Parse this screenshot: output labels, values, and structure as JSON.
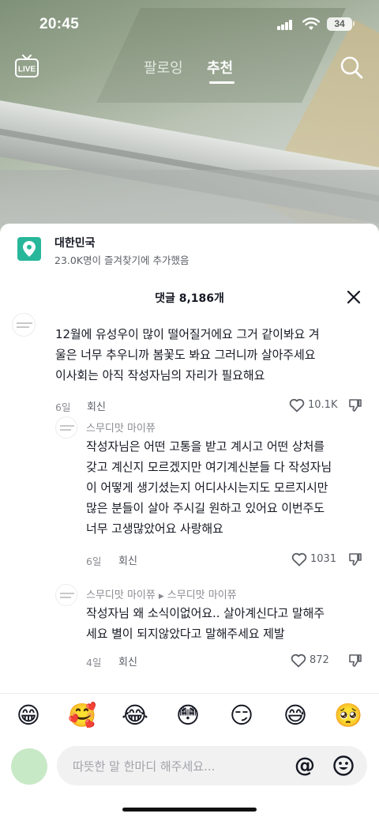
{
  "status_bar": {
    "time": "20:45",
    "battery": "34"
  },
  "top_nav": {
    "live_label": "LIVE",
    "tabs": [
      {
        "label": "팔로잉",
        "active": false
      },
      {
        "label": "추천",
        "active": true
      }
    ]
  },
  "location": {
    "title": "대한민국",
    "subtitle": "23.0K명이 즐겨찾기에 추가했음",
    "icon_color": "#28b79a"
  },
  "comments_header": {
    "title": "댓글 8,186개"
  },
  "comments": [
    {
      "name": "",
      "text": "12월에 유성우이 많이 떨어질거에요 그거 같이봐요 겨\n울은 너무 추우니까 봄꽃도 봐요 그러니까 살아주세요\n이사회는 아직 작성자님의 자리가 필요해요",
      "date": "6일",
      "reply": "회신",
      "likes": "10.1K"
    },
    {
      "name": "스무디맛 마이쮸",
      "text": "작성자님은 어떤 고통을 받고 계시고 어떤 상처를\n갖고 계신지 모르겠지만 여기계신분들 다 작성자님\n이 어떻게 생기셨는지 어디사시는지도 모르지시만\n많은 분들이 살아 주시길 원하고 있어요 이번주도\n너무 고생많았어요 사랑해요",
      "date": "6일",
      "reply": "회신",
      "likes": "1031"
    },
    {
      "name": "스무디맛 마이쮸",
      "reply_to": "스무디맛 마이쮸",
      "text": "작성자님 왜 소식이없어요.. 살아계신다고 말해주\n세요 별이 되지않았다고 말해주세요 제발",
      "date": "4일",
      "reply": "회신",
      "likes": "872"
    }
  ],
  "emoji_bar": [
    "😁",
    "🥰",
    "😂",
    "😳",
    "😏",
    "😅",
    "🥺"
  ],
  "input": {
    "placeholder": "따뜻한 말 한마디 해주세요...",
    "at_label": "@"
  },
  "colors": {
    "accent": "#28b79a",
    "avatar_bg": "#c8e9c6",
    "input_bg": "#f1f1f2"
  }
}
